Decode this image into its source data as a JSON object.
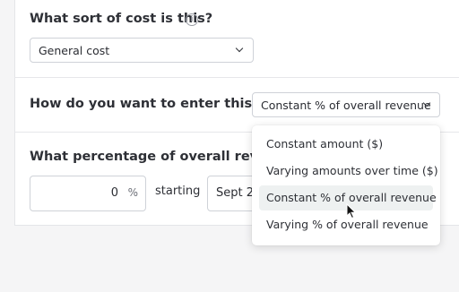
{
  "cost_type": {
    "question": "What sort of cost is this?",
    "info_glyph": "i",
    "selected": "General cost"
  },
  "entry_method": {
    "question": "How do you want to enter this cost?",
    "selected": "Constant % of overall revenue",
    "options": [
      "Constant amount ($)",
      "Varying amounts over time ($)",
      "Constant % of overall revenue",
      "Varying % of overall revenue"
    ],
    "highlighted_index": 2
  },
  "percentage": {
    "question": "What percentage of overall revenue?",
    "value": "0",
    "unit": "%",
    "starting_label": "starting",
    "start_date": "Sept 2"
  }
}
